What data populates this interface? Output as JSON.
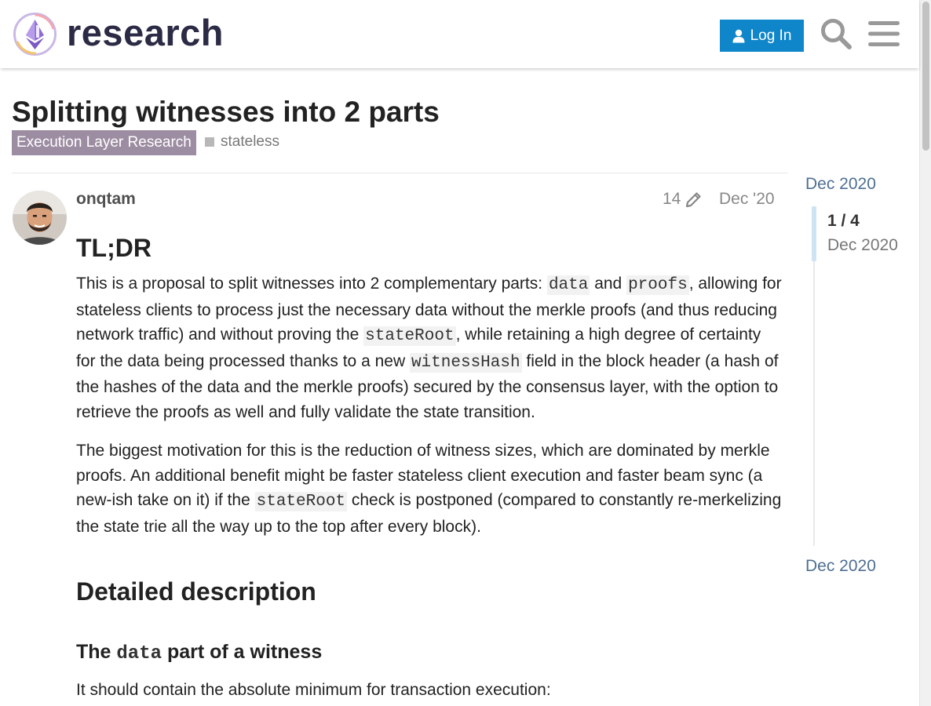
{
  "header": {
    "logo_text": "research",
    "login_label": "Log In",
    "search_icon": "search-icon",
    "menu_icon": "hamburger-menu-icon"
  },
  "topic": {
    "title": "Splitting witnesses into 2 parts",
    "category": "Execution Layer Research",
    "tag": "stateless",
    "category_color": "#9d8da2"
  },
  "post": {
    "username": "onqtam",
    "edit_count": "14",
    "date": "Dec '20",
    "heading_tldr": "TL;DR",
    "p1": {
      "t1": "This is a proposal to split witnesses into 2 complementary parts: ",
      "c1": "data",
      "t2": " and ",
      "c2": "proofs",
      "t3": ", allowing for stateless clients to process just the necessary data without the merkle proofs (and thus reducing network traffic) and without proving the ",
      "c3": "stateRoot",
      "t4": ", while retaining a high degree of certainty for the data being processed thanks to a new ",
      "c4": "witnessHash",
      "t5": " field in the block header (a hash of the hashes of the data and the merkle proofs) secured by the consensus layer, with the option to retrieve the proofs as well and fully validate the state transition."
    },
    "p2": {
      "t1": "The biggest motivation for this is the reduction of witness sizes, which are dominated by merkle proofs. An additional benefit might be faster stateless client execution and faster beam sync (a new-ish take on it) if the ",
      "c1": "stateRoot",
      "t2": " check is postponed (compared to constantly re-merkelizing the state trie all the way up to the top after every block)."
    },
    "heading_detailed": "Detailed description",
    "heading_data_part": {
      "t1": "The ",
      "c1": "data",
      "t2": " part of a witness"
    },
    "p3": "It should contain the absolute minimum for transaction execution:"
  },
  "timeline": {
    "top_label": "Dec 2020",
    "position": "1 / 4",
    "current_date": "Dec 2020",
    "bottom_label": "Dec 2020"
  },
  "colors": {
    "accent": "#0f86c9",
    "link": "#4e6f93"
  }
}
